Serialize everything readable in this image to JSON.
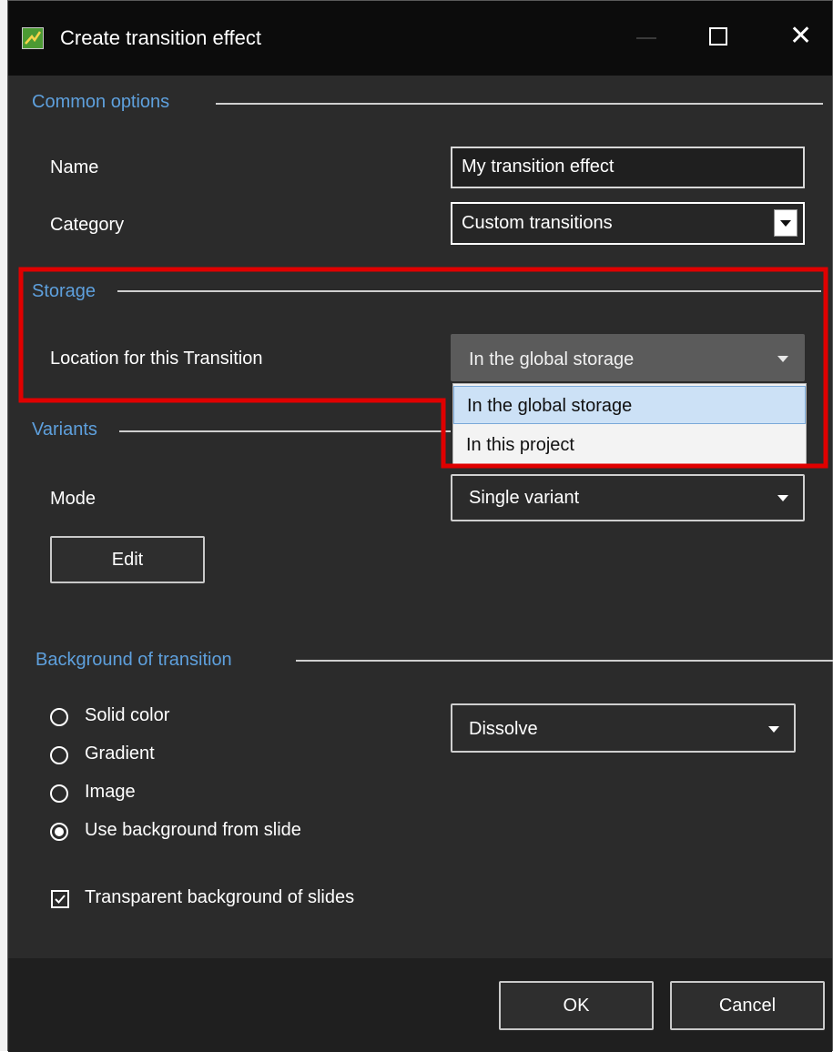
{
  "window": {
    "title": "Create transition effect"
  },
  "common": {
    "heading": "Common options",
    "name_label": "Name",
    "name_value": "My transition effect",
    "category_label": "Category",
    "category_value": "Custom transitions"
  },
  "storage": {
    "heading": "Storage",
    "location_label": "Location for this Transition",
    "location_value": "In the global storage",
    "options": [
      "In the global storage",
      "In this project"
    ]
  },
  "variants": {
    "heading": "Variants",
    "mode_label": "Mode",
    "mode_value": "Single variant",
    "edit_label": "Edit"
  },
  "background": {
    "heading": "Background of transition",
    "radios": [
      "Solid color",
      "Gradient",
      "Image",
      "Use background from slide"
    ],
    "selected_radio": "Use background from slide",
    "effect_value": "Dissolve",
    "transparent_label": "Transparent background of slides",
    "transparent_checked": true
  },
  "footer": {
    "ok_label": "OK",
    "cancel_label": "Cancel"
  },
  "colors": {
    "accent_heading": "#5ea0dd",
    "highlight_box": "#e00000",
    "dialog_bg": "#2b2b2b"
  }
}
